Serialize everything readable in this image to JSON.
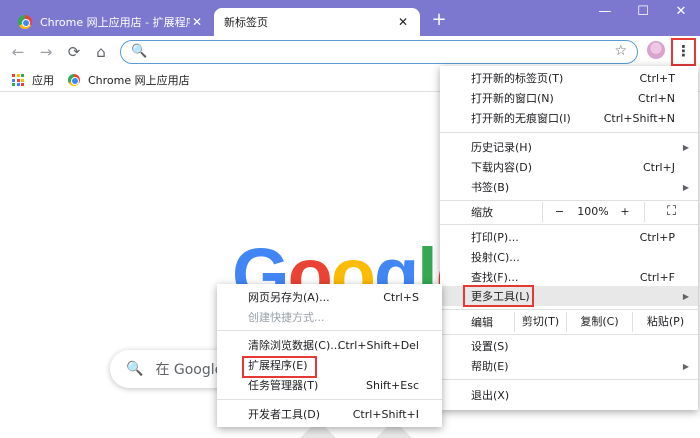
{
  "tabs": [
    {
      "title": "Chrome 网上应用店 - 扩展程序",
      "close": "✕"
    },
    {
      "title": "新标签页",
      "close": "✕"
    }
  ],
  "new_tab": "+",
  "window_controls": {
    "minimize": "—",
    "maximize": "☐",
    "close": "✕"
  },
  "toolbar": {
    "back": "←",
    "forward": "→",
    "reload": "⟳",
    "home": "⌂",
    "search_glyph": "🔍",
    "star": "☆",
    "menu_glyph": "⋮"
  },
  "omnibox": {
    "value": ""
  },
  "bookmarks": [
    {
      "label": "应用",
      "icon": "apps-icon"
    },
    {
      "label": "Chrome 网上应用店",
      "icon": "webstore-icon"
    }
  ],
  "google_logo": [
    "G",
    "o",
    "o",
    "g",
    "l",
    "e"
  ],
  "google_colors": [
    "#4285f4",
    "#ea4335",
    "#fbbc05",
    "#4285f4",
    "#34a853",
    "#ea4335"
  ],
  "google_search": {
    "placeholder": "在 Google"
  },
  "main_menu": {
    "new_tab": {
      "label": "打开新的标签页(T)",
      "shortcut": "Ctrl+T"
    },
    "new_window": {
      "label": "打开新的窗口(N)",
      "shortcut": "Ctrl+N"
    },
    "incognito": {
      "label": "打开新的无痕窗口(I)",
      "shortcut": "Ctrl+Shift+N"
    },
    "history": {
      "label": "历史记录(H)"
    },
    "downloads": {
      "label": "下载内容(D)",
      "shortcut": "Ctrl+J"
    },
    "bookmarks": {
      "label": "书签(B)"
    },
    "zoom": {
      "label": "缩放",
      "minus": "−",
      "value": "100%",
      "plus": "+",
      "fullscreen": "⛶"
    },
    "print": {
      "label": "打印(P)...",
      "shortcut": "Ctrl+P"
    },
    "cast": {
      "label": "投射(C)..."
    },
    "find": {
      "label": "查找(F)...",
      "shortcut": "Ctrl+F"
    },
    "more_tools": {
      "label": "更多工具(L)"
    },
    "edit": {
      "label": "编辑",
      "cut": "剪切(T)",
      "copy": "复制(C)",
      "paste": "粘贴(P)"
    },
    "settings": {
      "label": "设置(S)"
    },
    "help": {
      "label": "帮助(E)"
    },
    "exit": {
      "label": "退出(X)"
    }
  },
  "sub_menu": {
    "save_page": {
      "label": "网页另存为(A)...",
      "shortcut": "Ctrl+S"
    },
    "create_shortcut": {
      "label": "创建快捷方式..."
    },
    "clear_data": {
      "label": "清除浏览数据(C)...",
      "shortcut": "Ctrl+Shift+Del"
    },
    "extensions": {
      "label": "扩展程序(E)"
    },
    "task_manager": {
      "label": "任务管理器(T)",
      "shortcut": "Shift+Esc"
    },
    "dev_tools": {
      "label": "开发者工具(D)",
      "shortcut": "Ctrl+Shift+I"
    }
  },
  "colors": {
    "tabstrip": "#7c78cf",
    "highlight_box": "#e53935",
    "omnibox_focus": "#5b9bd5"
  }
}
